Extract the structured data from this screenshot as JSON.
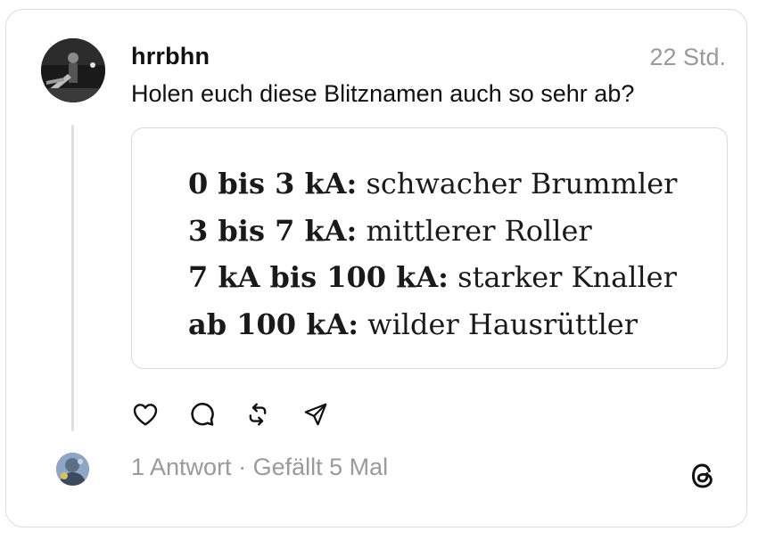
{
  "post": {
    "username": "hrrbhn",
    "timestamp": "22 Std.",
    "text": "Holen euch diese Blitznamen auch so sehr ab?",
    "avatar": "profile-photo"
  },
  "quote_image": {
    "lines": [
      {
        "key": "0 bis 3 kA:",
        "value": " schwacher Brummler"
      },
      {
        "key": "3 bis 7 kA:",
        "value": " mittlerer Roller"
      },
      {
        "key": "7 kA bis 100 kA:",
        "value": " starker Knaller"
      },
      {
        "key": "ab 100 kA:",
        "value": " wilder Hausrüttler"
      }
    ]
  },
  "actions": [
    {
      "name": "like",
      "icon": "heart-icon"
    },
    {
      "name": "reply",
      "icon": "comment-icon"
    },
    {
      "name": "repost",
      "icon": "repost-icon"
    },
    {
      "name": "share",
      "icon": "send-icon"
    }
  ],
  "footer": {
    "replies": "1 Antwort",
    "separator": " · ",
    "likes": "Gefällt 5 Mal"
  },
  "colors": {
    "text": "#111111",
    "muted": "#9a9a9a",
    "border": "#dcdcdc",
    "thread_line": "#dedede"
  }
}
